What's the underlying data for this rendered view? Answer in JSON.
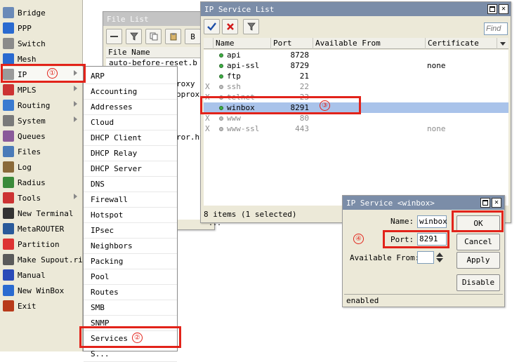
{
  "sidebar": {
    "items": [
      {
        "label": "Bridge",
        "icon": "bridge-icon",
        "submenu": false
      },
      {
        "label": "PPP",
        "icon": "ppp-icon",
        "submenu": false
      },
      {
        "label": "Switch",
        "icon": "switch-icon",
        "submenu": false
      },
      {
        "label": "Mesh",
        "icon": "mesh-icon",
        "submenu": false
      },
      {
        "label": "IP",
        "icon": "ip-icon",
        "submenu": true
      },
      {
        "label": "MPLS",
        "icon": "mpls-icon",
        "submenu": true
      },
      {
        "label": "Routing",
        "icon": "routing-icon",
        "submenu": true
      },
      {
        "label": "System",
        "icon": "system-icon",
        "submenu": true
      },
      {
        "label": "Queues",
        "icon": "queues-icon",
        "submenu": false
      },
      {
        "label": "Files",
        "icon": "files-icon",
        "submenu": false
      },
      {
        "label": "Log",
        "icon": "log-icon",
        "submenu": false
      },
      {
        "label": "Radius",
        "icon": "radius-icon",
        "submenu": false
      },
      {
        "label": "Tools",
        "icon": "tools-icon",
        "submenu": true
      },
      {
        "label": "New Terminal",
        "icon": "terminal-icon",
        "submenu": false
      },
      {
        "label": "MetaROUTER",
        "icon": "metarouter-icon",
        "submenu": false
      },
      {
        "label": "Partition",
        "icon": "partition-icon",
        "submenu": false
      },
      {
        "label": "Make Supout.rif",
        "icon": "supout-icon",
        "submenu": false
      },
      {
        "label": "Manual",
        "icon": "manual-icon",
        "submenu": false
      },
      {
        "label": "New WinBox",
        "icon": "winbox-icon",
        "submenu": false
      },
      {
        "label": "Exit",
        "icon": "exit-icon",
        "submenu": false
      }
    ]
  },
  "file_list": {
    "title": "File List",
    "column": "File Name",
    "rows": [
      "auto-before-reset.b",
      "roxy",
      "oproxy",
      "ror.ht"
    ],
    "button_fragment": "B",
    "footer_fragment": "..."
  },
  "ip_menu": {
    "items": [
      "ARP",
      "Accounting",
      "Addresses",
      "Cloud",
      "DHCP Client",
      "DHCP Relay",
      "DHCP Server",
      "DNS",
      "Firewall",
      "Hotspot",
      "IPsec",
      "Neighbors",
      "Packing",
      "Pool",
      "Routes",
      "SMB",
      "SNMP",
      "Services",
      "S..."
    ]
  },
  "service_list": {
    "title": "IP Service List",
    "find_placeholder": "Find",
    "columns": [
      "Name",
      "Port",
      "Available From",
      "Certificate"
    ],
    "rows": [
      {
        "flag": "",
        "name": "api",
        "port": "8728",
        "from": "",
        "cert": "",
        "enabled": true
      },
      {
        "flag": "",
        "name": "api-ssl",
        "port": "8729",
        "from": "",
        "cert": "none",
        "enabled": true
      },
      {
        "flag": "",
        "name": "ftp",
        "port": "21",
        "from": "",
        "cert": "",
        "enabled": true
      },
      {
        "flag": "X",
        "name": "ssh",
        "port": "22",
        "from": "",
        "cert": "",
        "enabled": false
      },
      {
        "flag": "X",
        "name": "telnet",
        "port": "23",
        "from": "",
        "cert": "",
        "enabled": false
      },
      {
        "flag": "",
        "name": "winbox",
        "port": "8291",
        "from": "",
        "cert": "",
        "enabled": true,
        "selected": true
      },
      {
        "flag": "X",
        "name": "www",
        "port": "80",
        "from": "",
        "cert": "",
        "enabled": false
      },
      {
        "flag": "X",
        "name": "www-ssl",
        "port": "443",
        "from": "",
        "cert": "none",
        "enabled": false
      }
    ],
    "status": "8 items (1 selected)"
  },
  "service_dialog": {
    "title": "IP Service <winbox>",
    "name_label": "Name:",
    "name_value": "winbox",
    "port_label": "Port:",
    "port_value": "8291",
    "available_label": "Available From:",
    "buttons": {
      "ok": "OK",
      "cancel": "Cancel",
      "apply": "Apply",
      "disable": "Disable"
    },
    "status": "enabled"
  },
  "annotations": {
    "step1": "①",
    "step2": "②",
    "step3": "③",
    "step4": "④"
  },
  "colors": {
    "highlight": "#e2231a",
    "selected_row": "#a9c3ea",
    "active_title": "#7b8da8"
  }
}
